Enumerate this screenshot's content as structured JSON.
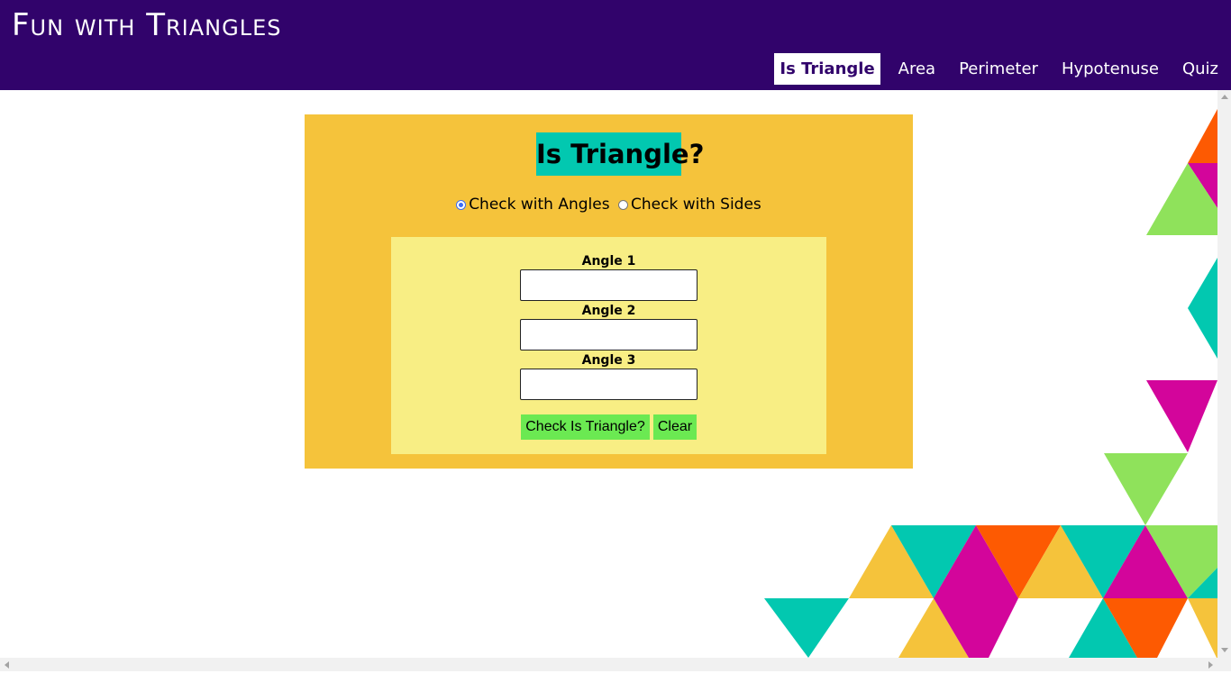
{
  "app": {
    "title": "Fun with Triangles"
  },
  "nav": {
    "items": [
      {
        "label": "Is Triangle",
        "active": true
      },
      {
        "label": "Area",
        "active": false
      },
      {
        "label": "Perimeter",
        "active": false
      },
      {
        "label": "Hypotenuse",
        "active": false
      },
      {
        "label": "Quiz",
        "active": false
      }
    ]
  },
  "main": {
    "heading": "Is Triangle?",
    "mode_options": [
      {
        "label": "Check with Angles",
        "checked": true
      },
      {
        "label": "Check with Sides",
        "checked": false
      }
    ],
    "fields": [
      {
        "label": "Angle 1",
        "value": ""
      },
      {
        "label": "Angle 2",
        "value": ""
      },
      {
        "label": "Angle 3",
        "value": ""
      }
    ],
    "buttons": {
      "check": "Check Is Triangle?",
      "clear": "Clear"
    }
  },
  "colors": {
    "header_bg": "#31036b",
    "card_bg": "#f5c33b",
    "panel_bg": "#f8ee84",
    "heading_bg": "#02c8b0",
    "button_bg": "#6be952",
    "deco_orange": "#fd5a02",
    "deco_pink": "#d3059b",
    "deco_green": "#8fe25b",
    "deco_teal": "#02c8b0",
    "deco_yellow": "#f5c33b"
  }
}
